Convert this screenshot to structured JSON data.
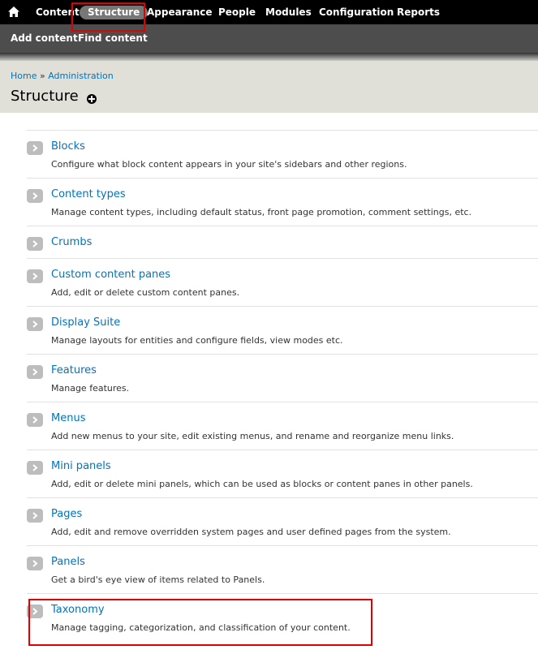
{
  "toolbar": {
    "home_icon": "home-icon",
    "items": [
      {
        "label": "Content"
      },
      {
        "label": "Structure",
        "active": true
      },
      {
        "label": "Appearance"
      },
      {
        "label": "People"
      },
      {
        "label": "Modules"
      },
      {
        "label": "Configuration"
      },
      {
        "label": "Reports"
      }
    ]
  },
  "shortcuts": {
    "items": [
      {
        "label": "Add content"
      },
      {
        "label": "Find content"
      }
    ]
  },
  "breadcrumb": {
    "home": "Home",
    "separator": "»",
    "administration": "Administration"
  },
  "page": {
    "title": "Structure",
    "add_shortcut_icon": "plus-circle-icon"
  },
  "items": [
    {
      "title": "Blocks",
      "description": "Configure what block content appears in your site's sidebars and other regions."
    },
    {
      "title": "Content types",
      "description": "Manage content types, including default status, front page promotion, comment settings, etc."
    },
    {
      "title": "Crumbs",
      "description": ""
    },
    {
      "title": "Custom content panes",
      "description": "Add, edit or delete custom content panes."
    },
    {
      "title": "Display Suite",
      "description": "Manage layouts for entities and configure fields, view modes etc."
    },
    {
      "title": "Features",
      "description": "Manage features."
    },
    {
      "title": "Menus",
      "description": "Add new menus to your site, edit existing menus, and rename and reorganize menu links."
    },
    {
      "title": "Mini panels",
      "description": "Add, edit or delete mini panels, which can be used as blocks or content panes in other panels."
    },
    {
      "title": "Pages",
      "description": "Add, edit and remove overridden system pages and user defined pages from the system."
    },
    {
      "title": "Panels",
      "description": "Get a bird's eye view of items related to Panels."
    },
    {
      "title": "Taxonomy",
      "description": "Manage tagging, categorization, and classification of your content."
    }
  ],
  "colors": {
    "link": "#0074bd",
    "highlight": "#e00000",
    "toolbar_bg": "#000000"
  }
}
